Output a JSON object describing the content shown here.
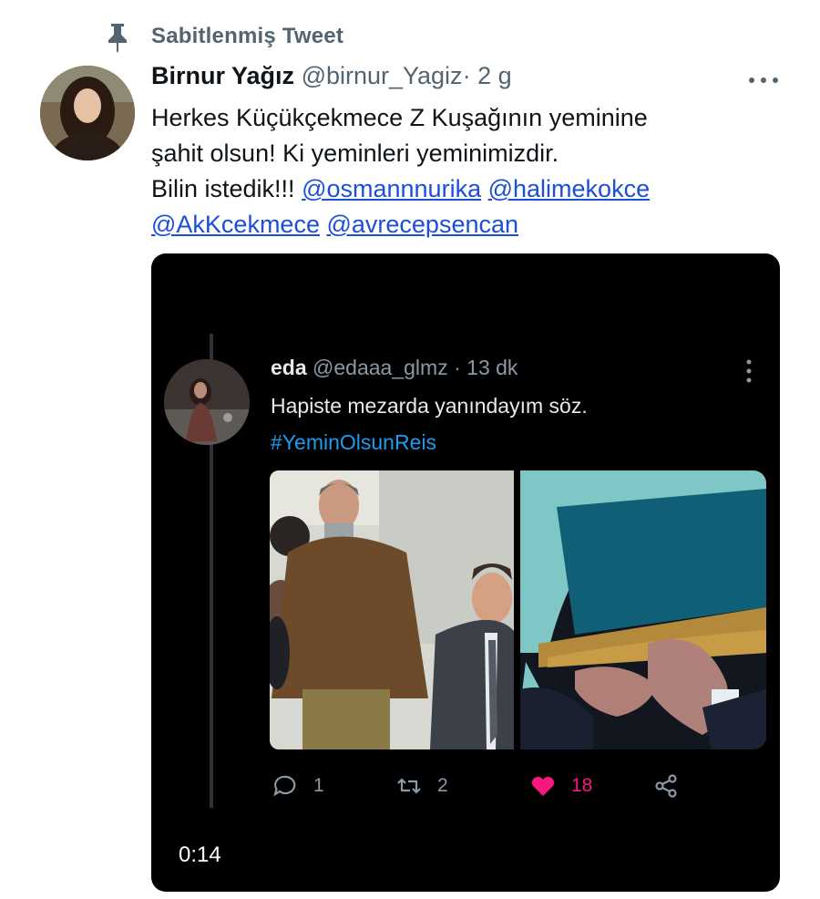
{
  "pinned": {
    "label": "Sabitlenmiş Tweet",
    "icon": "pin-icon"
  },
  "tweet": {
    "display_name": "Birnur Yağız",
    "handle": "@birnur_Yagiz",
    "separator": "·",
    "time": "2 g",
    "text_lines": [
      "Herkes Küçükçekmece Z Kuşağının yeminine",
      "şahit olsun! Ki yeminleri yeminimizdir.",
      "Bilin istedik!!!"
    ],
    "mentions": [
      "@osmannnurika",
      "@halimekokce",
      "@AkKcekmece",
      "@avrecepsencan"
    ],
    "more_icon": "more-horizontal-icon"
  },
  "media": {
    "video_time": "0:14",
    "inner_tweet": {
      "display_name": "eda",
      "handle": "@edaaa_glmz",
      "separator": "·",
      "time": "13 dk",
      "text": "Hapiste mezarda yanındayım söz.",
      "hashtag": "#YeminOlsunReis",
      "stats": {
        "replies": "1",
        "retweets": "2",
        "likes": "18"
      }
    }
  },
  "colors": {
    "link": "#1d4ed8",
    "secondary_text": "#536471",
    "like": "#f91880",
    "hashtag": "#1d9bf0"
  }
}
